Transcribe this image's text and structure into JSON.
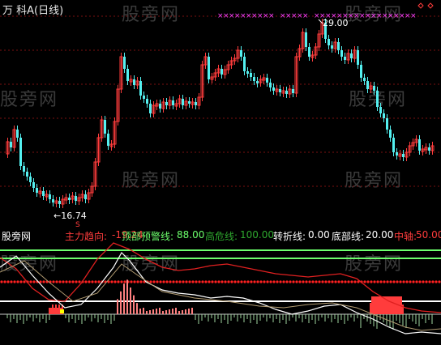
{
  "title": "万 科A(日线)",
  "annotations": {
    "high_label": "29.00",
    "low_label": "←16.74",
    "s_marker": "S"
  },
  "watermark": "股旁网",
  "indicator_bar": {
    "source": "股旁网",
    "main_name": "主力趋向:",
    "main_value": "-19.24",
    "top_warn_name": "顶部预警线:",
    "top_warn_value": "88.00",
    "danger_name": "高危线:",
    "danger_value": "100.00",
    "turn_name": "转折线:",
    "turn_value": "0.00",
    "bottom_name": "底部线:",
    "bottom_value": "20.00",
    "axis_name": "中轴:",
    "axis_value": "50.00"
  },
  "colors": {
    "up": "#ff3c3c",
    "down": "#54f0f0",
    "green_line": "#6cff6c",
    "red_dots": "#ff2020",
    "white_line": "#ffffff",
    "magenta": "#ff40ff",
    "yellow": "#ffff00"
  }
}
